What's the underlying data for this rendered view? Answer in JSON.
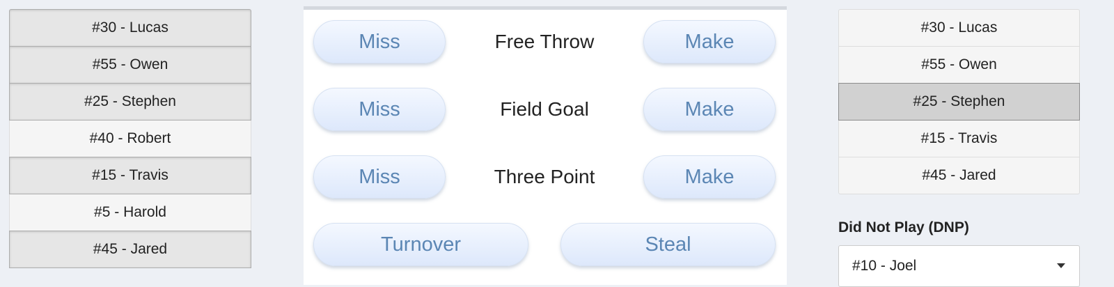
{
  "left_roster": [
    {
      "label": "#30 - Lucas",
      "active": true
    },
    {
      "label": "#55 - Owen",
      "active": true
    },
    {
      "label": "#25 - Stephen",
      "active": true
    },
    {
      "label": "#40 - Robert",
      "active": false
    },
    {
      "label": "#15 - Travis",
      "active": true
    },
    {
      "label": "#5 - Harold",
      "active": false
    },
    {
      "label": "#45 - Jared",
      "active": true
    }
  ],
  "stats": {
    "free_throw": {
      "miss": "Miss",
      "label": "Free Throw",
      "make": "Make"
    },
    "field_goal": {
      "miss": "Miss",
      "label": "Field Goal",
      "make": "Make"
    },
    "three_point": {
      "miss": "Miss",
      "label": "Three Point",
      "make": "Make"
    },
    "turnover": "Turnover",
    "steal": "Steal"
  },
  "right_roster": [
    {
      "label": "#30 - Lucas",
      "selected": false
    },
    {
      "label": "#55 - Owen",
      "selected": false
    },
    {
      "label": "#25 - Stephen",
      "selected": true
    },
    {
      "label": "#15 - Travis",
      "selected": false
    },
    {
      "label": "#45 - Jared",
      "selected": false
    }
  ],
  "dnp": {
    "label": "Did Not Play (DNP)",
    "selected": "#10 - Joel"
  },
  "colors": {
    "button_text": "#5b86b4",
    "page_bg": "#edf0f5"
  }
}
